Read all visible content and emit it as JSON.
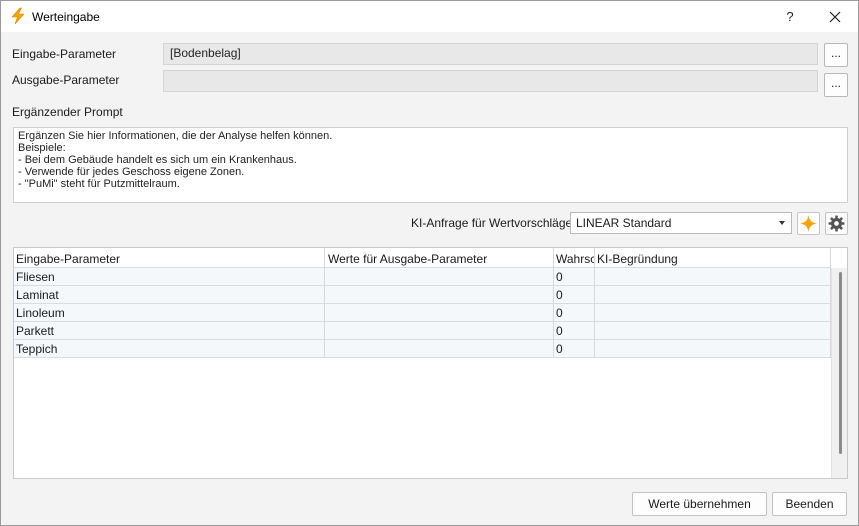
{
  "window": {
    "title": "Werteingabe",
    "help_label": "?",
    "close_label": "✕"
  },
  "input_param": {
    "label": "Eingabe-Parameter",
    "value": "[Bodenbelag]",
    "browse_label": "..."
  },
  "output_param": {
    "label": "Ausgabe-Parameter",
    "value": "",
    "browse_label": "..."
  },
  "prompt": {
    "label": "Ergänzender Prompt",
    "lines": [
      "Ergänzen Sie hier Informationen, die der Analyse helfen können.",
      "Beispiele:",
      "- Bei dem Gebäude handelt es sich um ein Krankenhaus.",
      "- Verwende für jedes Geschoss eigene Zonen.",
      "- \"PuMi\" steht für Putzmittelraum."
    ]
  },
  "ai_request": {
    "label": "KI-Anfrage für Wertvorschläge:",
    "selected": "LINEAR Standard",
    "accent_color": "#f5a300"
  },
  "grid": {
    "columns": [
      "Eingabe-Parameter",
      "Werte für Ausgabe-Parameter",
      "Wahrscheinlichkeit",
      "KI-Begründung"
    ],
    "rows": [
      [
        "Fliesen",
        "",
        "0",
        ""
      ],
      [
        "Laminat",
        "",
        "0",
        ""
      ],
      [
        "Linoleum",
        "",
        "0",
        ""
      ],
      [
        "Parkett",
        "",
        "0",
        ""
      ],
      [
        "Teppich",
        "",
        "0",
        ""
      ]
    ]
  },
  "footer": {
    "apply_label": "Werte übernehmen",
    "exit_label": "Beenden"
  }
}
